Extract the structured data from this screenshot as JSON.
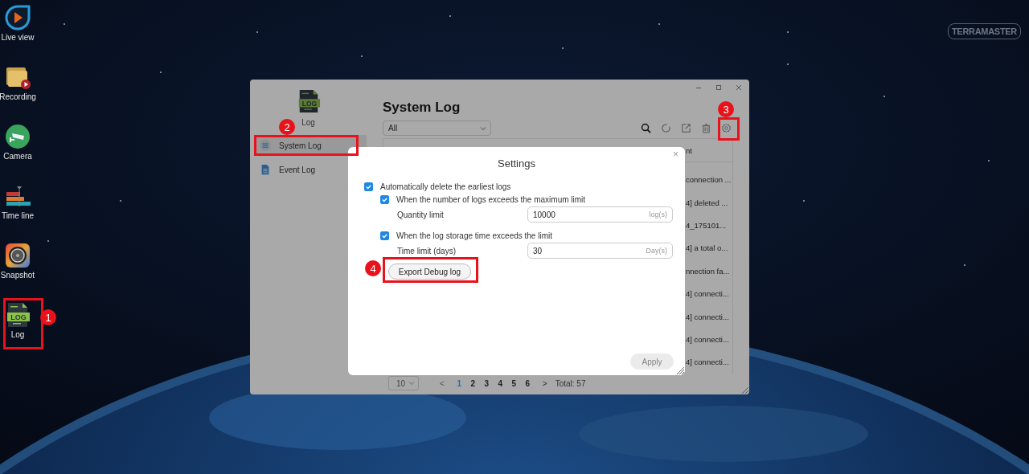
{
  "desktop": {
    "logo": "TERRAMASTER",
    "icons": [
      {
        "label": "Live view",
        "kind": "live"
      },
      {
        "label": "Recording",
        "kind": "recording"
      },
      {
        "label": "Camera",
        "kind": "camera"
      },
      {
        "label": "Time line",
        "kind": "timeline"
      },
      {
        "label": "Snapshot",
        "kind": "snapshot"
      },
      {
        "label": "Log",
        "kind": "log",
        "icon_text": "LOG"
      }
    ]
  },
  "window": {
    "app": {
      "name": "Log",
      "icon_text": "LOG"
    },
    "sidebar": {
      "items": [
        {
          "label": "System Log",
          "selected": true,
          "kind": "list"
        },
        {
          "label": "Event Log",
          "selected": false,
          "kind": "doc"
        }
      ]
    },
    "title": "System Log",
    "filter": {
      "value": "All"
    },
    "table": {
      "columns": [
        "nt"
      ],
      "rows": [
        "connection ...",
        "4] deleted ...",
        "4_175101...",
        "4] a total o...",
        "nnection fa...",
        "4] connecti...",
        "4] connecti...",
        "4] connecti...",
        "4] connecti..."
      ]
    },
    "pagination": {
      "page_size": "10",
      "prev": "<",
      "next": ">",
      "pages": [
        {
          "label": "1",
          "selected": true
        },
        {
          "label": "2",
          "selected": false
        },
        {
          "label": "3",
          "selected": false
        },
        {
          "label": "4",
          "selected": false
        },
        {
          "label": "5",
          "selected": false
        },
        {
          "label": "6",
          "selected": false
        }
      ],
      "total": "Total: 57"
    }
  },
  "dialog": {
    "title": "Settings",
    "close": "×",
    "option": {
      "label": "Automatically delete the earliest logs",
      "checked": true,
      "children": [
        {
          "label": "When the number of logs exceeds the maximum limit",
          "checked": true,
          "field_label": "Quantity limit",
          "value": "10000",
          "unit": "log(s)"
        },
        {
          "label": "When the log storage time exceeds the limit",
          "checked": true,
          "field_label": "Time limit (days)",
          "value": "30",
          "unit": "Day(s)"
        }
      ]
    },
    "export_button": "Export Debug log",
    "apply_button": {
      "label": "Apply",
      "disabled": true
    }
  },
  "annotations": [
    {
      "number": "1"
    },
    {
      "number": "2"
    },
    {
      "number": "3"
    },
    {
      "number": "4"
    }
  ]
}
